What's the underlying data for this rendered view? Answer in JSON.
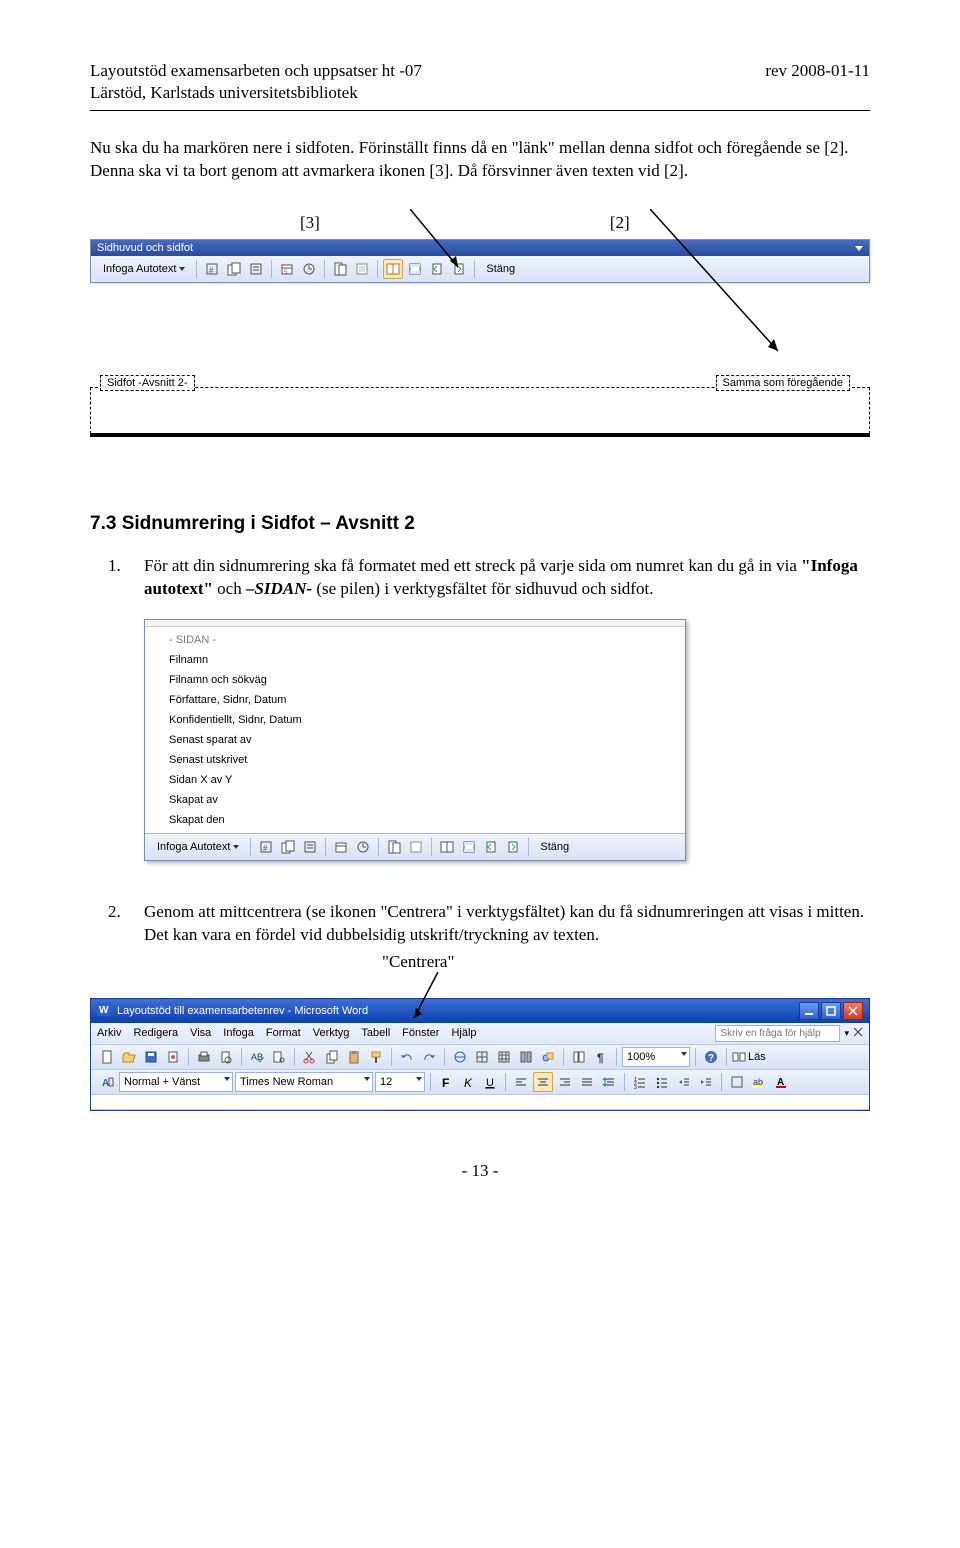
{
  "header": {
    "title_left": "Layoutstöd examensarbeten och uppsatser ht -07",
    "title_right": "rev 2008-01-11",
    "subtitle": "Lärstöd, Karlstads universitetsbibliotek"
  },
  "para1": "Nu ska du ha markören nere i sidfoten. Förinställt finns då en \"länk\" mellan denna sidfot och föregående se [2]. Denna ska vi ta bort genom att avmarkera ikonen [3]. Då försvinner även texten vid [2].",
  "ref3": "[3]",
  "ref2": "[2]",
  "hf": {
    "title": "Sidhuvud och sidfot",
    "autotext": "Infoga Autotext",
    "close": "Stäng"
  },
  "footer": {
    "tab_left": "Sidfot -Avsnitt 2-",
    "tab_right": "Samma som föregående"
  },
  "sect_head": "7.3 Sidnumrering i Sidfot – Avsnitt 2",
  "li1_num": "1.",
  "li1_a": "För att din sidnumrering ska få formatet med ett streck på varje sida om numret kan du gå in via ",
  "li1_b": "\"Infoga autotext\"",
  "li1_c": " och ",
  "li1_d": "–SIDAN-",
  "li1_e": " (se pilen) i verktygsfältet för sidhuvud och sidfot.",
  "menu": {
    "items": [
      "- SIDAN -",
      "Filnamn",
      "Filnamn och sökväg",
      "Författare, Sidnr, Datum",
      "Konfidentiellt, Sidnr, Datum",
      "Senast sparat av",
      "Senast utskrivet",
      "Sidan X av Y",
      "Skapat av",
      "Skapat den"
    ],
    "autotext": "Infoga Autotext",
    "close": "Stäng"
  },
  "li2_num": "2.",
  "li2_a": "Genom att mittcentrera (se ikonen \"Centrera\" i verktygsfältet) kan du få sidnumreringen att visas i mitten. Det kan vara en fördel vid dubbelsidig utskrift/tryckning av texten.",
  "li2_b": "\"Centrera\"",
  "word": {
    "title": "Layoutstöd till examensarbetenrev - Microsoft Word",
    "menus": [
      "Arkiv",
      "Redigera",
      "Visa",
      "Infoga",
      "Format",
      "Verktyg",
      "Tabell",
      "Fönster",
      "Hjälp"
    ],
    "help_ph": "Skriv en fråga för hjälp",
    "zoom": "100%",
    "las": "Läs",
    "style": "Normal + Vänst",
    "font": "Times New Roman",
    "size": "12"
  },
  "page_num": "- 13 -"
}
